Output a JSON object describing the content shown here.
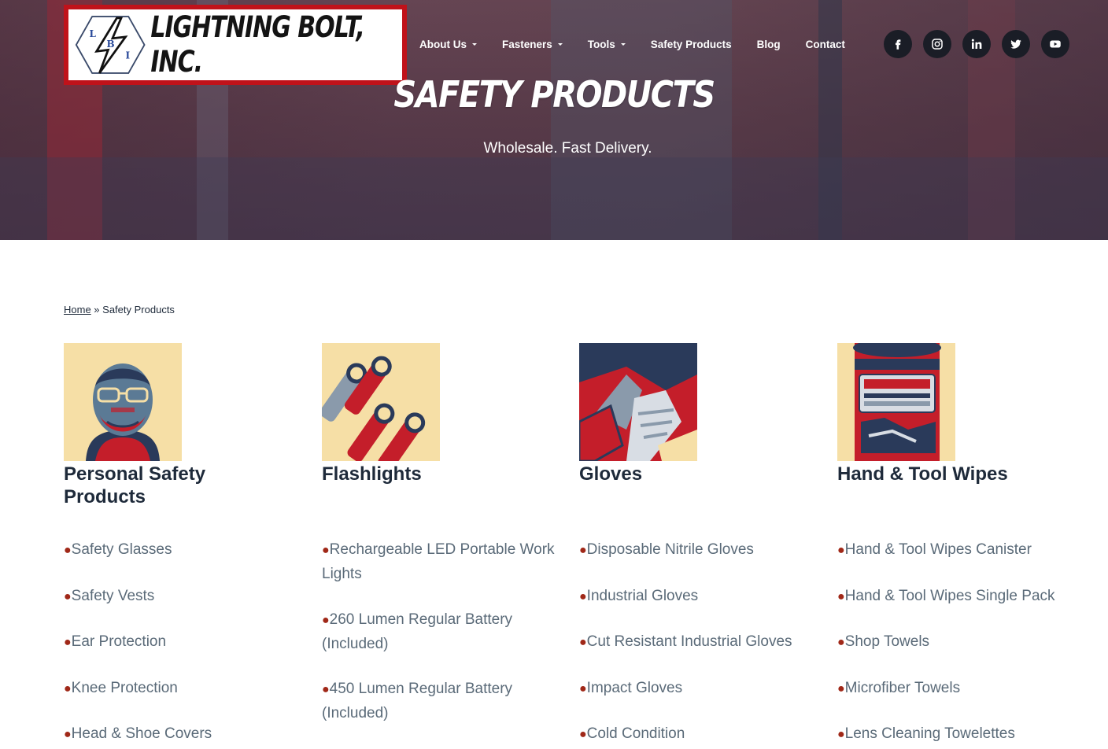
{
  "brand": {
    "logo_letters": [
      "L",
      "B",
      "I"
    ],
    "name": "LIGHTNING BOLT, INC."
  },
  "nav": {
    "items": [
      {
        "label": "About Us",
        "has_dropdown": true
      },
      {
        "label": "Fasteners",
        "has_dropdown": true
      },
      {
        "label": "Tools",
        "has_dropdown": true
      },
      {
        "label": "Safety Products",
        "has_dropdown": false
      },
      {
        "label": "Blog",
        "has_dropdown": false
      },
      {
        "label": "Contact",
        "has_dropdown": false
      }
    ]
  },
  "socials": [
    "facebook-icon",
    "instagram-icon",
    "linkedin-icon",
    "twitter-icon",
    "youtube-icon"
  ],
  "hero": {
    "title": "SAFETY PRODUCTS",
    "subtitle": "Wholesale. Fast Delivery."
  },
  "breadcrumb": {
    "home": "Home",
    "separator": " » ",
    "current": "Safety Products"
  },
  "bullet": "●",
  "categories": [
    {
      "title": "Personal Safety Products",
      "items": [
        "Safety Glasses",
        "Safety Vests",
        "Ear Protection",
        "Knee Protection",
        "Head & Shoe Covers"
      ]
    },
    {
      "title": "Flashlights",
      "items": [
        "Rechargeable LED Portable Work Lights",
        "260 Lumen Regular Battery (Included)",
        "450 Lumen Regular Battery (Included)"
      ]
    },
    {
      "title": "Gloves",
      "items": [
        "Disposable Nitrile Gloves",
        "Industrial Gloves",
        "Cut Resistant Industrial Gloves",
        "Impact Gloves",
        "Cold Condition"
      ]
    },
    {
      "title": "Hand & Tool Wipes",
      "items": [
        "Hand & Tool Wipes Canister",
        "Hand & Tool Wipes Single Pack",
        "Shop Towels",
        "Microfiber Towels",
        "Lens Cleaning Towelettes"
      ]
    }
  ],
  "colors": {
    "logo_border": "#c0121a",
    "bullet": "#a02818",
    "heading": "#1e2a3a",
    "link": "#5a6a78"
  }
}
